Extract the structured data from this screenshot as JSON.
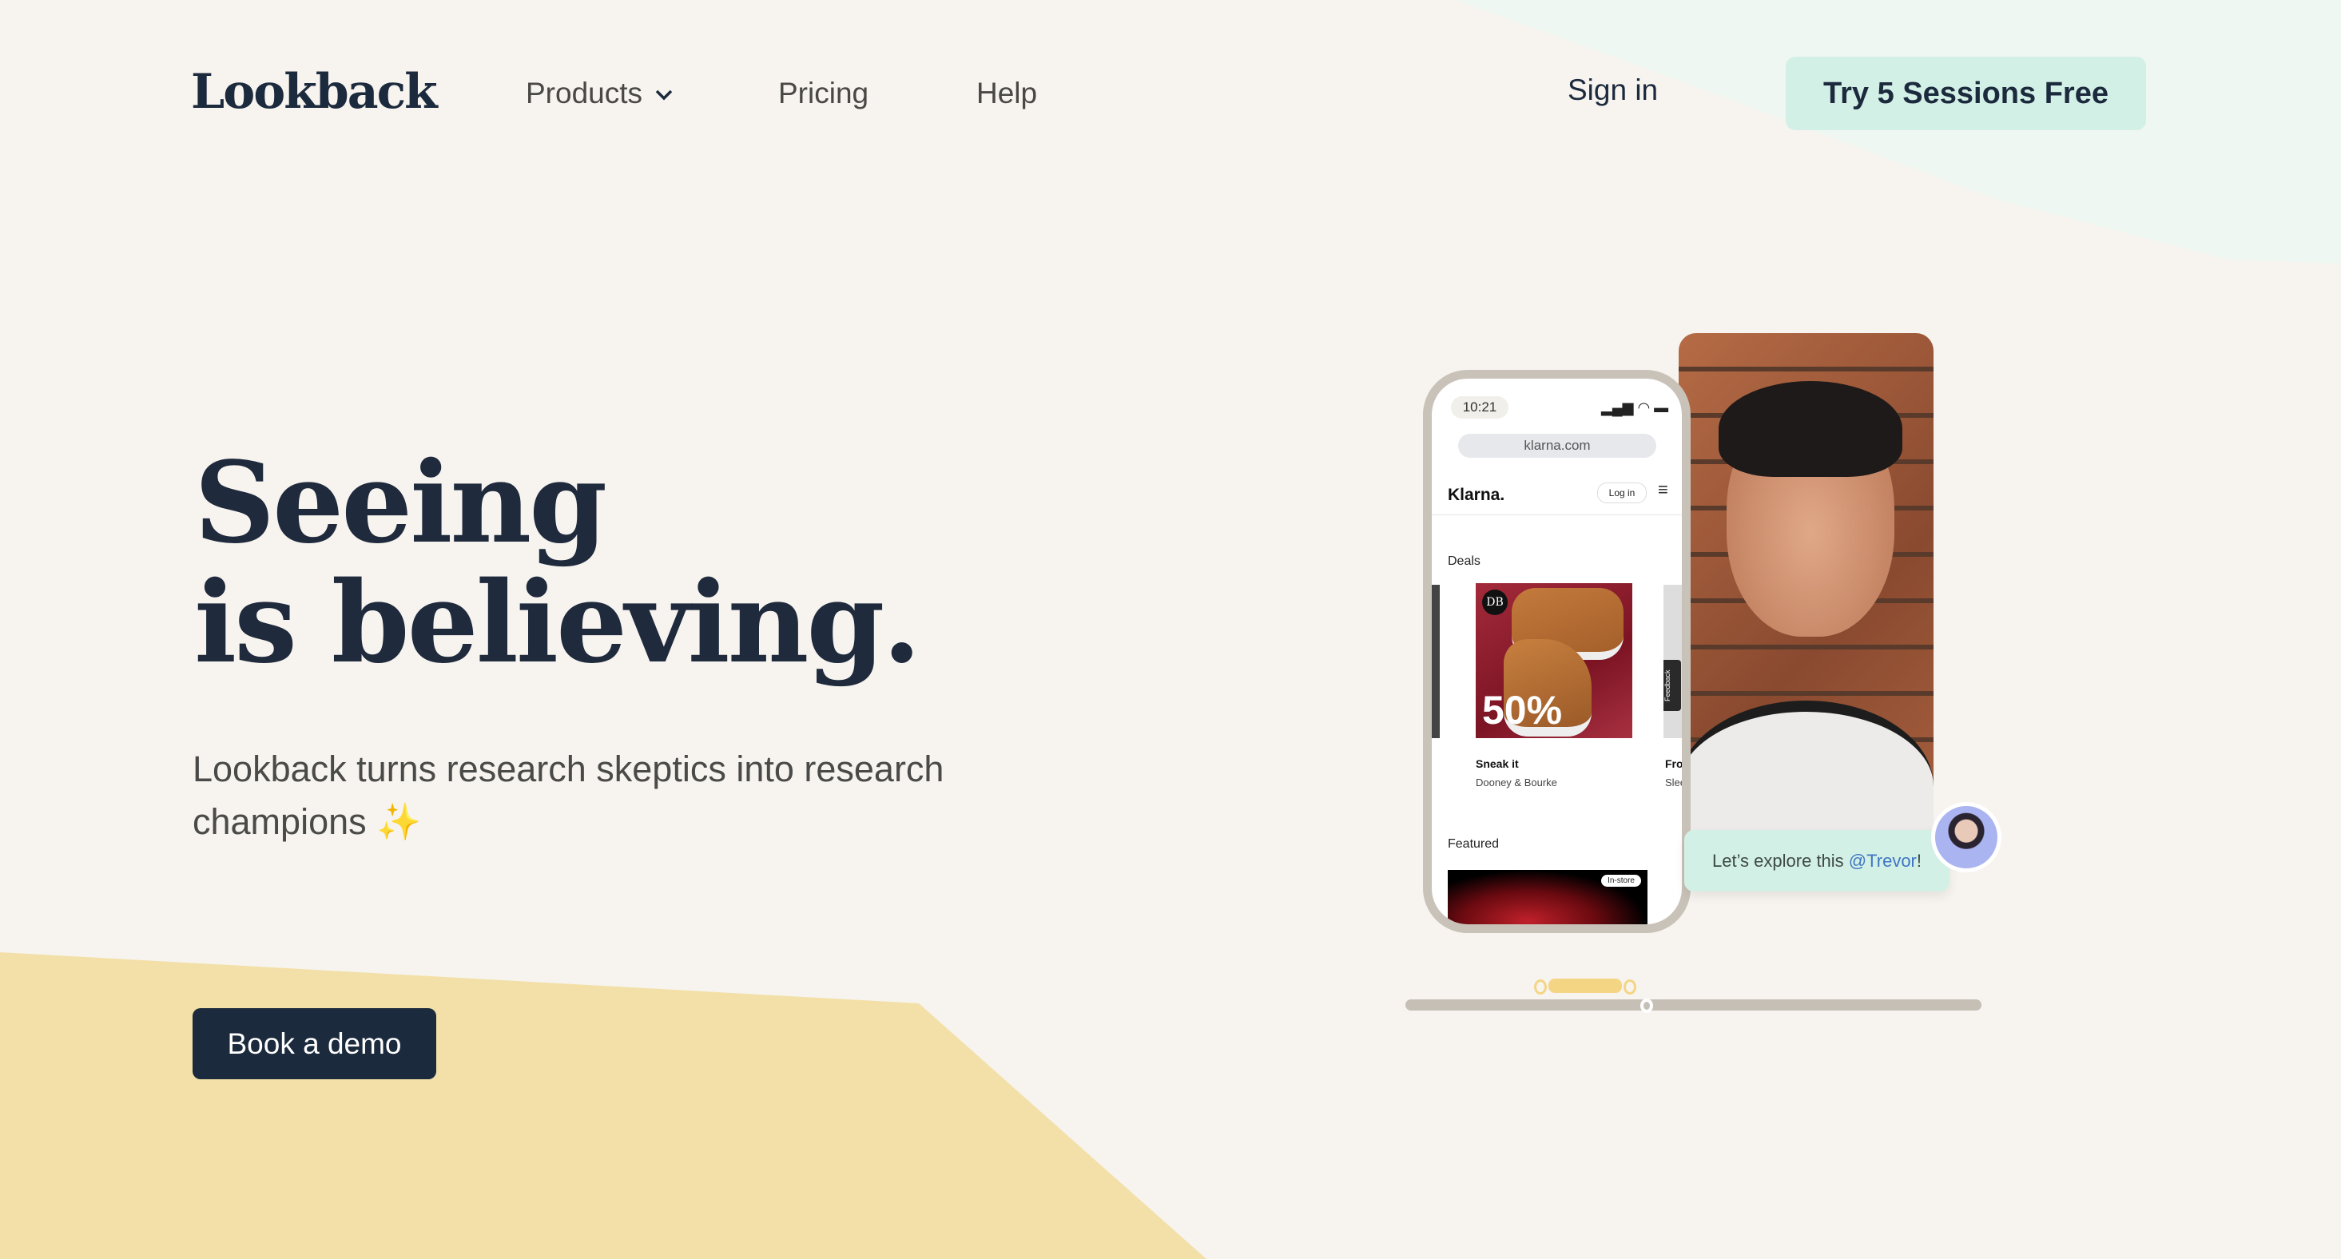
{
  "header": {
    "logo": "Lookback",
    "nav": [
      {
        "label": "Products",
        "icon": "chevron-down-icon"
      },
      {
        "label": "Pricing"
      },
      {
        "label": "Help"
      }
    ],
    "sign_in": "Sign in",
    "cta": "Try 5 Sessions Free"
  },
  "hero": {
    "headline_line1": "Seeing",
    "headline_line2": "is believing.",
    "subtitle": "Lookback turns research skeptics into research champions",
    "sparkle_icon": "sparkles-icon",
    "book_demo": "Book a demo"
  },
  "phone": {
    "time": "10:21",
    "url": "klarna.com",
    "brand": "Klarna.",
    "login": "Log in",
    "deals_label": "Deals",
    "deal_badge": "DB",
    "deal_discount": "50%",
    "deal_title": "Sneak it",
    "deal_brand": "Dooney & Bourke",
    "next_deal_title": "Fro",
    "next_deal_brand": "Slee",
    "feedback_tab": "Feedback",
    "featured_label": "Featured",
    "featured_tag": "In-store"
  },
  "comment": {
    "text": "Let’s explore this ",
    "mention": "@Trevor",
    "suffix": "!"
  },
  "colors": {
    "navy": "#1c2a3d",
    "mint": "#d3f0e6",
    "yellow": "#f2e0a8",
    "background": "#f7f4ef",
    "mention": "#3f76c4"
  }
}
